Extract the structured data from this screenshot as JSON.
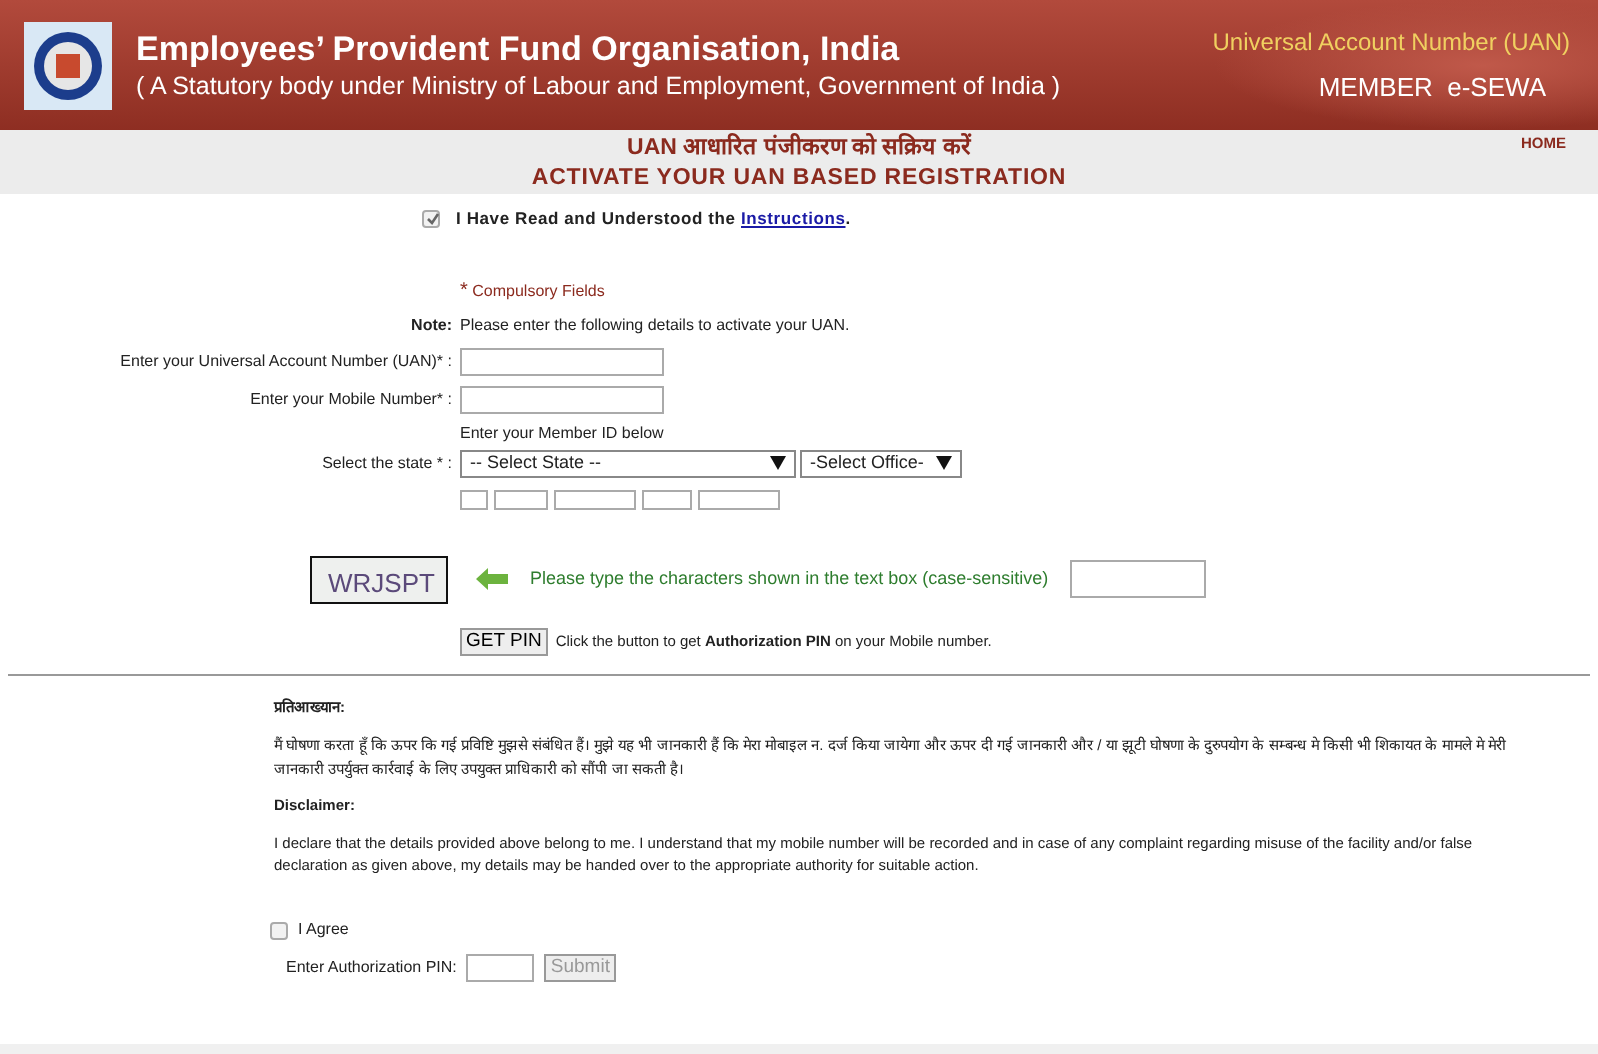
{
  "header": {
    "title": "Employees’ Provident Fund Organisation, India",
    "subtitle": "( A Statutory body under Ministry of Labour and Employment, Government of India )",
    "uan_label": "Universal Account Number (UAN)",
    "member_label": "MEMBER  e-SEWA"
  },
  "page_title_hindi": "UAN आधारित पंजीकरण को सक्रिय करें",
  "page_title": "ACTIVATE YOUR UAN BASED REGISTRATION",
  "home_link": "HOME",
  "instructions_check": {
    "checked": true,
    "text": "I Have Read and Understood the ",
    "link": "Instructions",
    "tail": "."
  },
  "compulsory": {
    "star": "*",
    "text": "Compulsory Fields"
  },
  "note": {
    "label": "Note:",
    "text": "Please enter the following details to activate your UAN."
  },
  "uan_field": {
    "label": "Enter your Universal Account Number (UAN)* :"
  },
  "mobile_field": {
    "label": "Enter your Mobile Number* :"
  },
  "member_id_hint": "Enter your Member ID below",
  "state_field": {
    "label": "Select the state * :",
    "state_value": "-- Select State --",
    "office_value": "-Select Office-"
  },
  "captcha": {
    "code": "WRJSPT",
    "prompt": "Please type the characters shown in the text box (case-sensitive)"
  },
  "get_pin": {
    "button": "GET PIN",
    "text": "Click the button to get **Authorization PIN** on your Mobile number."
  },
  "declaration_hindi": {
    "heading": "प्रतिआख्यान:",
    "text": "मैं घोषणा करता हूँ कि ऊपर कि गई प्रविष्टि मुझसे संबंधित हैं। मुझे यह भी जानकारी हैं कि मेरा मोबाइल न. दर्ज किया जायेगा और ऊपर दी गई जानकारी और / या झूटी घोषणा के दुरुपयोग के सम्बन्ध मे किसी भी शिकायत के मामले मे मेरी जानकारी उपर्युक्त कार्रवाई के लिए उपयुक्त प्राधिकारी को सौंपी जा सकती है।"
  },
  "disclaimer": {
    "heading": "Disclaimer:",
    "text": "I declare that the details provided above belong to me. I understand that my mobile number will be recorded and in case of any complaint regarding misuse of the facility and/or false declaration as given above, my details may be handed over to the appropriate authority for suitable action."
  },
  "agree": {
    "checked": false,
    "label": "I Agree"
  },
  "pin": {
    "label": "Enter Authorization PIN:",
    "button": "Submit",
    "disabled": true
  }
}
